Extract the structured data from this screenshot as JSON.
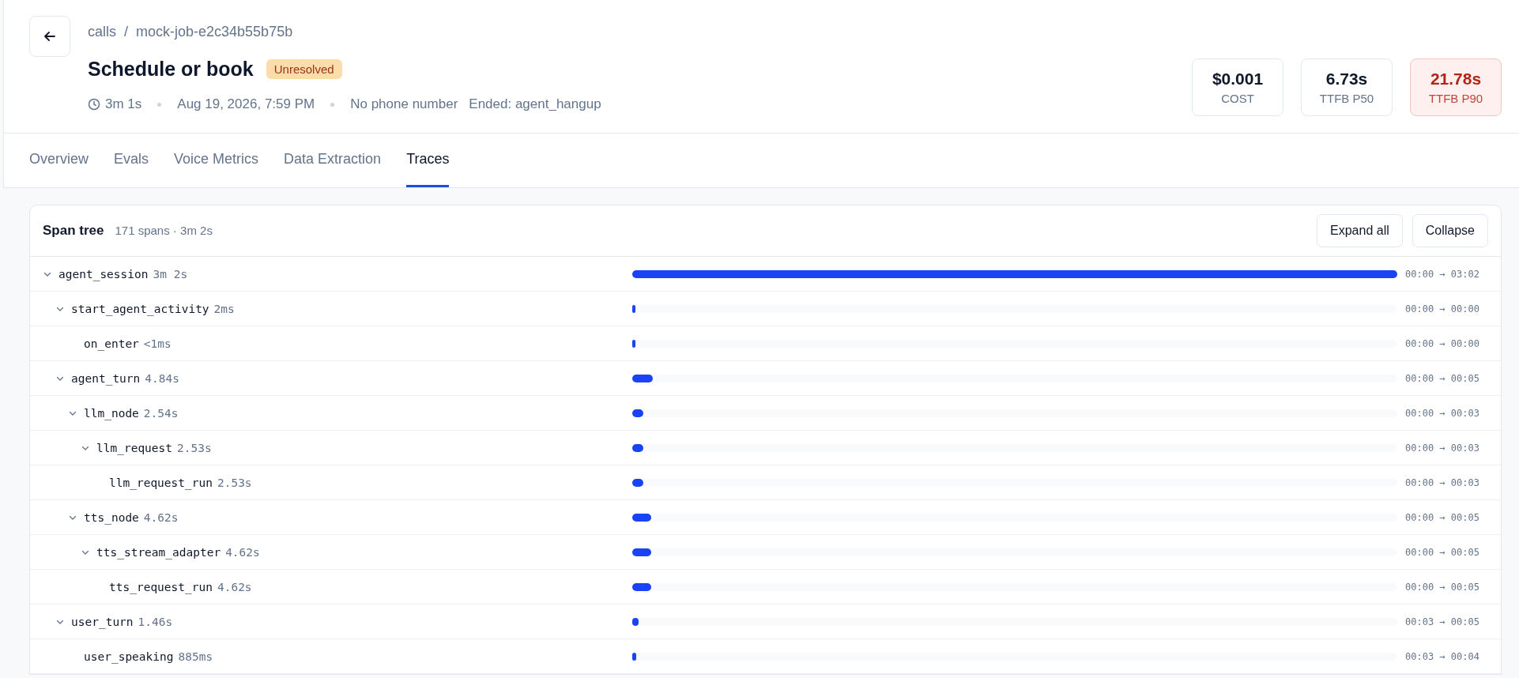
{
  "breadcrumb": [
    "calls",
    "/",
    "mock-job-e2c34b55b75b"
  ],
  "title": "Schedule or book",
  "status_badge": "Unresolved",
  "meta": {
    "duration": "3m 1s",
    "date": "Aug 19, 2026, 7:59 PM",
    "phone": "No phone number",
    "ended": "Ended: agent_hangup"
  },
  "stats": [
    {
      "value": "$0.001",
      "label": "COST",
      "kind": "normal"
    },
    {
      "value": "6.73s",
      "label": "TTFB P50",
      "kind": "normal"
    },
    {
      "value": "21.78s",
      "label": "TTFB P90",
      "kind": "alert"
    }
  ],
  "tabs": [
    {
      "label": "Overview",
      "selected": false
    },
    {
      "label": "Evals",
      "selected": false
    },
    {
      "label": "Voice Metrics",
      "selected": false
    },
    {
      "label": "Data Extraction",
      "selected": false
    },
    {
      "label": "Traces",
      "selected": true
    }
  ],
  "span_tree": {
    "title": "Span tree",
    "summary": "171 spans · 3m 2s",
    "buttons": [
      "Expand all",
      "Collapse"
    ],
    "spans": [
      {
        "name": "agent_session",
        "duration": "3m 2s",
        "range": "00:00 → 03:02",
        "level": 1,
        "expanded": true,
        "children": [
          {
            "name": "start_agent_activity",
            "duration": "2ms",
            "range": "00:00 → 00:00",
            "level": 0.003,
            "expanded": true,
            "children": [
              {
                "name": "on_enter",
                "duration": "<1ms",
                "range": "00:00 → 00:00",
                "level": 0.003
              }
            ]
          },
          {
            "name": "agent_turn",
            "duration": "4.84s",
            "range": "00:00 → 00:05",
            "level": 0.027,
            "expanded": true,
            "children": [
              {
                "name": "llm_node",
                "duration": "2.54s",
                "range": "00:00 → 00:03",
                "level": 0.014,
                "expanded": true,
                "children": [
                  {
                    "name": "llm_request",
                    "duration": "2.53s",
                    "range": "00:00 → 00:03",
                    "level": 0.014,
                    "expanded": true,
                    "children": [
                      {
                        "name": "llm_request_run",
                        "duration": "2.53s",
                        "range": "00:00 → 00:03",
                        "level": 0.014
                      }
                    ]
                  }
                ]
              },
              {
                "name": "tts_node",
                "duration": "4.62s",
                "range": "00:00 → 00:05",
                "level": 0.025,
                "expanded": true,
                "children": [
                  {
                    "name": "tts_stream_adapter",
                    "duration": "4.62s",
                    "range": "00:00 → 00:05",
                    "level": 0.025,
                    "expanded": true,
                    "children": [
                      {
                        "name": "tts_request_run",
                        "duration": "4.62s",
                        "range": "00:00 → 00:05",
                        "level": 0.025
                      }
                    ]
                  }
                ]
              }
            ]
          },
          {
            "name": "user_turn",
            "duration": "1.46s",
            "range": "00:03 → 00:05",
            "level": 0.008,
            "expanded": true,
            "children": [
              {
                "name": "user_speaking",
                "duration": "885ms",
                "range": "00:03 → 00:04",
                "level": 0.005
              }
            ]
          }
        ]
      }
    ]
  }
}
